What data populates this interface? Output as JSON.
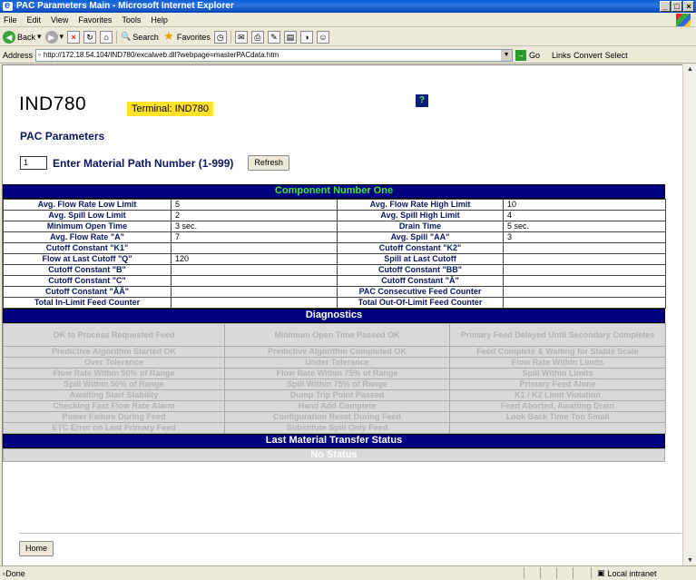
{
  "window": {
    "title": "PAC Parameters Main - Microsoft Internet Explorer",
    "controls": [
      "_",
      "□",
      "×"
    ]
  },
  "menu": [
    "File",
    "Edit",
    "View",
    "Favorites",
    "Tools",
    "Help"
  ],
  "toolbar": {
    "back": "Back",
    "search": "Search",
    "favorites": "Favorites"
  },
  "address": {
    "label": "Address",
    "url": "http://172.18.54.104/IND780/excalweb.dll?webpage=masterPACdata.htm",
    "go": "Go",
    "links": "Links",
    "convert": "Convert",
    "select": "Select"
  },
  "page": {
    "title": "IND780",
    "terminal": "Terminal: IND780",
    "help": "?",
    "pac_title": "PAC Parameters",
    "material_path_value": "1",
    "material_path_label": "Enter Material Path Number (1-999)",
    "refresh": "Refresh",
    "home": "Home"
  },
  "component": {
    "header": "Component Number One",
    "rows": [
      [
        "Avg. Flow Rate Low Limit",
        "5",
        "Avg. Flow Rate High Limit",
        "10"
      ],
      [
        "Avg. Spill Low Limit",
        "2",
        "Avg. Spill High Limit",
        "4"
      ],
      [
        "Minimum Open Time",
        "3 sec.",
        "Drain Time",
        "5 sec."
      ],
      [
        "Avg. Flow Rate \"A\"",
        "7",
        "Avg. Spill \"AA\"",
        "3"
      ],
      [
        "Cutoff Constant \"K1\"",
        "",
        "Cutoff Constant \"K2\"",
        ""
      ],
      [
        "Flow at Last Cutoff \"Q\"",
        "120",
        "Spill at Last Cutoff",
        ""
      ],
      [
        "Cutoff Constant \"B\"",
        "",
        "Cutoff Constant \"BB\"",
        ""
      ],
      [
        "Cutoff Constant \"C\"",
        "",
        "Cutoff Constant \"Â\"",
        ""
      ],
      [
        "Cutoff Constant \"ÂÂ\"",
        "",
        "PAC Consecutive Feed Counter",
        ""
      ],
      [
        "Total In-Limit Feed Counter",
        "",
        "Total Out-Of-Limit Feed Counter",
        ""
      ]
    ]
  },
  "diagnostics": {
    "header": "Diagnostics",
    "rows": [
      [
        "OK to Process Requested Feed",
        "Minimum Open Time Passed OK",
        "Primary Feed Delayed Until Secondary Completes"
      ],
      [
        "Predictive Algorithm Started OK",
        "Predictive Algorithm Completed OK",
        "Feed Complete & Waiting for Stable Scale"
      ],
      [
        "Over Tolerance",
        "Under Tolerance",
        "Flow Rate Within Limits"
      ],
      [
        "Flow Rate Within 50% of Range",
        "Flow Rate Within 75% of Range",
        "Spill Within Limits"
      ],
      [
        "Spill Within 50% of Range",
        "Spill Within 75% of Range",
        "Primary Feed Alone"
      ],
      [
        "Awaiting Start Stability",
        "Dump Trip Point Passed",
        "K1 / K2 Limit Violation"
      ],
      [
        "Checking Fast Flow Rate Alarm",
        "Hand Add Complete",
        "Feed Aborted, Awaiting Drain"
      ],
      [
        "Power Failure During Feed",
        "Configuration Reset During Feed",
        "Look Back Time Too Small"
      ],
      [
        "ETC Error on Last Primary Feed",
        "Substitute Spill Only Feed",
        ""
      ]
    ]
  },
  "transfer": {
    "header": "Last Material Transfer Status",
    "status": "No Status"
  },
  "status": {
    "left": "Done",
    "zone": "Local intranet"
  }
}
